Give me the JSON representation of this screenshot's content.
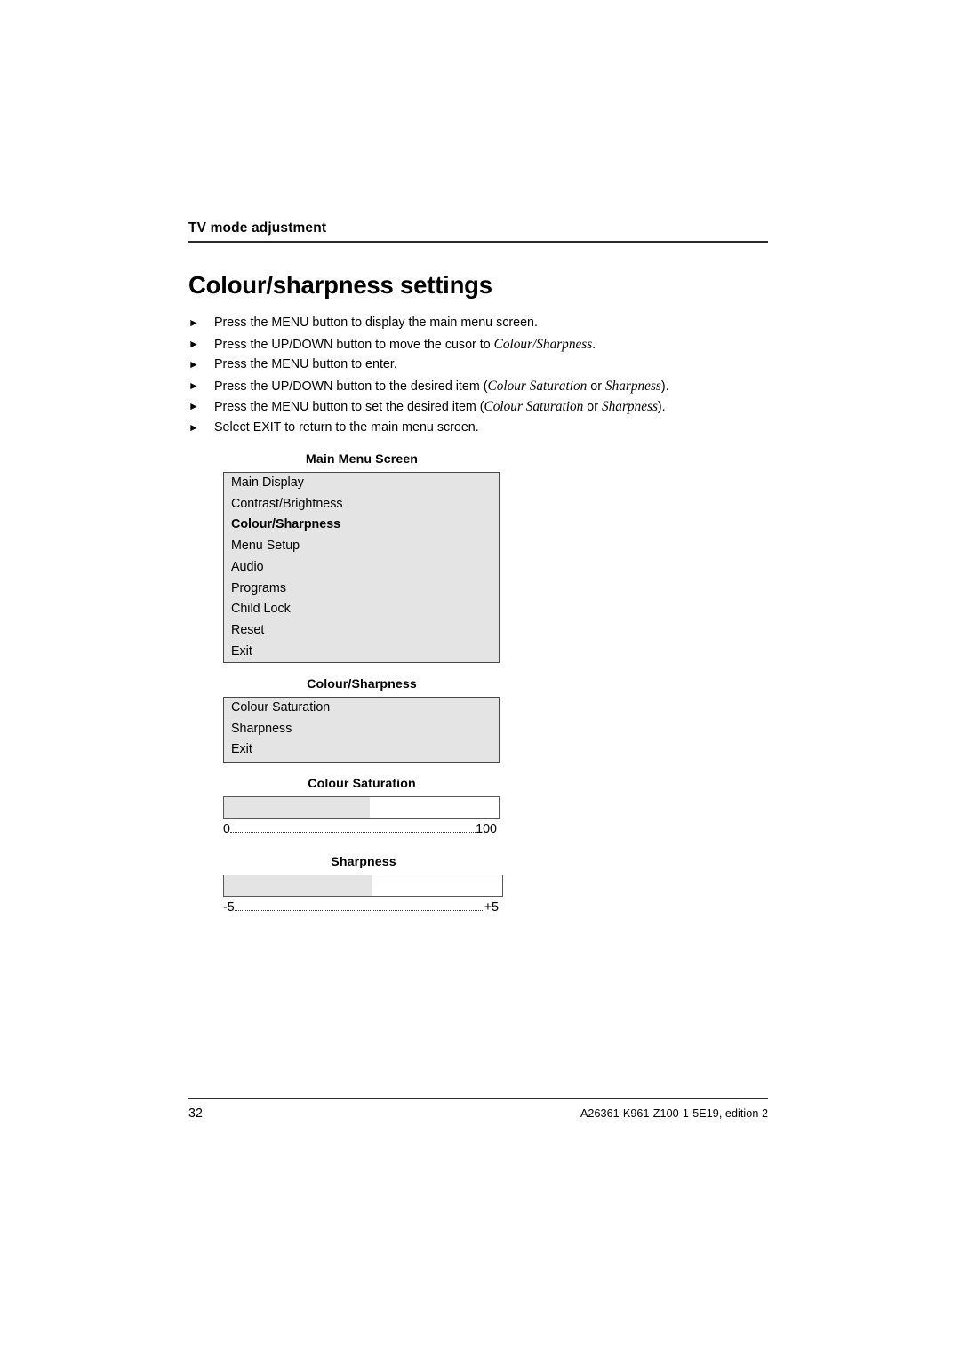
{
  "header": {
    "running_title": "TV mode adjustment"
  },
  "page_title": "Colour/sharpness settings",
  "bullets": {
    "marker": "►",
    "items": [
      {
        "segments": [
          {
            "text": "Press the MENU button to display the main menu screen.",
            "style": "normal"
          }
        ]
      },
      {
        "segments": [
          {
            "text": "Press the UP/DOWN  button to move the cusor to ",
            "style": "normal"
          },
          {
            "text": "Colour/Sharpness",
            "style": "italic"
          },
          {
            "text": ".",
            "style": "normal"
          }
        ]
      },
      {
        "segments": [
          {
            "text": "Press the MENU  button to enter.",
            "style": "normal"
          }
        ]
      },
      {
        "segments": [
          {
            "text": "Press the UP/DOWN button to the desired item (",
            "style": "normal"
          },
          {
            "text": "Colour Saturation",
            "style": "italic"
          },
          {
            "text": " or ",
            "style": "normal"
          },
          {
            "text": "Sharpness",
            "style": "italic"
          },
          {
            "text": ").",
            "style": "normal"
          }
        ]
      },
      {
        "segments": [
          {
            "text": "Press the MENU button to set the desired item (",
            "style": "normal"
          },
          {
            "text": "Colour Saturation",
            "style": "italic"
          },
          {
            "text": " or ",
            "style": "normal"
          },
          {
            "text": "Sharpness",
            "style": "italic"
          },
          {
            "text": ").",
            "style": "normal"
          }
        ]
      },
      {
        "segments": [
          {
            "text": "Select EXIT to return to the main menu screen.",
            "style": "normal"
          }
        ]
      }
    ]
  },
  "main_menu": {
    "caption": "Main Menu Screen",
    "items": [
      {
        "label": "Main Display",
        "selected": false
      },
      {
        "label": "Contrast/Brightness",
        "selected": false
      },
      {
        "label": "Colour/Sharpness",
        "selected": true
      },
      {
        "label": "Menu Setup",
        "selected": false
      },
      {
        "label": "Audio",
        "selected": false
      },
      {
        "label": "Programs",
        "selected": false
      },
      {
        "label": "Child Lock",
        "selected": false
      },
      {
        "label": "Reset",
        "selected": false
      },
      {
        "label": "Exit",
        "selected": false
      }
    ]
  },
  "colour_sharpness_menu": {
    "caption": "Colour/Sharpness",
    "items": [
      {
        "label": "Colour Saturation",
        "selected": false
      },
      {
        "label": "Sharpness",
        "selected": false
      },
      {
        "label": "Exit",
        "selected": false
      }
    ]
  },
  "colour_saturation_slider": {
    "caption": "Colour Saturation",
    "min_label": "0",
    "max_label": "100",
    "fill_percent": 53
  },
  "sharpness_slider": {
    "caption": "Sharpness",
    "min_label": "-5",
    "max_label": "+5",
    "fill_percent": 53
  },
  "footer": {
    "page_number": "32",
    "document_id": "A26361-K961-Z100-1-5E19, edition 2"
  },
  "colors": {
    "osd_fill": "#e4e4e4",
    "osd_border": "#474747",
    "rule": "#2c2c2c"
  }
}
